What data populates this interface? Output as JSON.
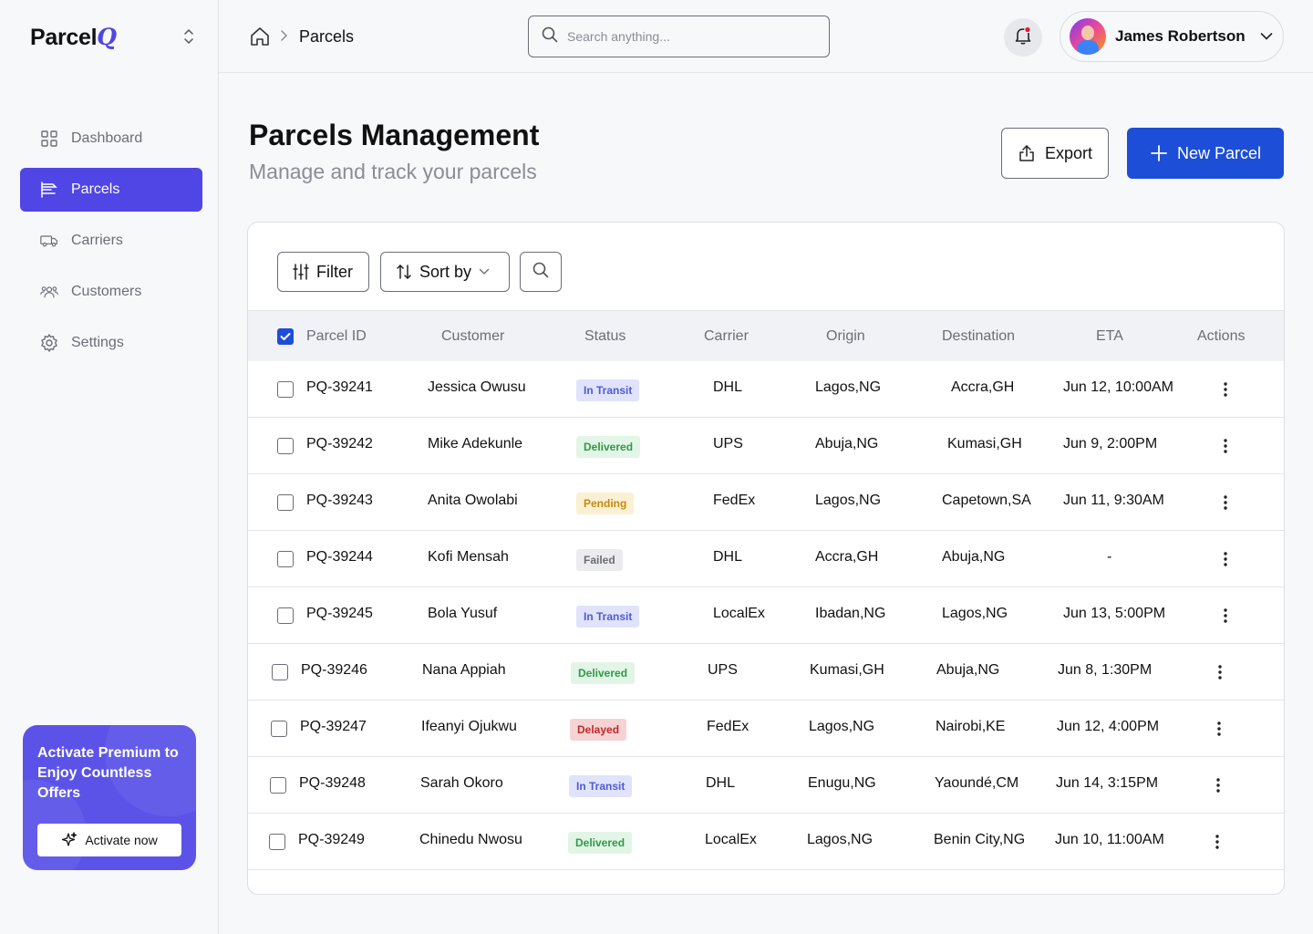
{
  "app": {
    "logo_main": "Parcel",
    "logo_accent": "Q"
  },
  "sidebar": {
    "items": [
      {
        "label": "Dashboard",
        "icon": "grid-icon",
        "active": false
      },
      {
        "label": "Parcels",
        "icon": "parcels-icon",
        "active": true
      },
      {
        "label": "Carriers",
        "icon": "truck-icon",
        "active": false
      },
      {
        "label": "Customers",
        "icon": "users-icon",
        "active": false
      },
      {
        "label": "Settings",
        "icon": "gear-icon",
        "active": false
      }
    ],
    "premium": {
      "text": "Activate Premium to Enjoy Countless Offers",
      "button_label": "Activate now"
    }
  },
  "header": {
    "breadcrumb_current": "Parcels",
    "search_placeholder": "Search anything...",
    "user_name": "James Robertson"
  },
  "main": {
    "title": "Parcels Management",
    "subtitle": "Manage and track your parcels",
    "export_label": "Export",
    "new_label": "New Parcel",
    "filter_label": "Filter",
    "sort_label": "Sort by"
  },
  "table": {
    "columns": [
      "Parcel ID",
      "Customer",
      "Status",
      "Carrier",
      "Origin",
      "Destination",
      "ETA",
      "Actions"
    ],
    "rows": [
      {
        "id": "PQ-39241",
        "customer": "Jessica Owusu",
        "status": "In Transit",
        "status_type": "transit",
        "carrier": "DHL",
        "origin": "Lagos,NG",
        "destination": "Accra,GH",
        "eta": "Jun 12, 10:00AM"
      },
      {
        "id": "PQ-39242",
        "customer": "Mike Adekunle",
        "status": "Delivered",
        "status_type": "delivered",
        "carrier": "UPS",
        "origin": "Abuja,NG",
        "destination": "Kumasi,GH",
        "eta": "Jun 9, 2:00PM"
      },
      {
        "id": "PQ-39243",
        "customer": "Anita Owolabi",
        "status": "Pending",
        "status_type": "pending",
        "carrier": "FedEx",
        "origin": "Lagos,NG",
        "destination": "Capetown,SA",
        "eta": "Jun 11, 9:30AM"
      },
      {
        "id": "PQ-39244",
        "customer": "Kofi Mensah",
        "status": "Failed",
        "status_type": "failed",
        "carrier": "DHL",
        "origin": "Accra,GH",
        "destination": "Abuja,NG",
        "eta": "-"
      },
      {
        "id": "PQ-39245",
        "customer": "Bola Yusuf",
        "status": "In Transit",
        "status_type": "transit",
        "carrier": "LocalEx",
        "origin": "Ibadan,NG",
        "destination": "Lagos,NG",
        "eta": "Jun 13, 5:00PM"
      },
      {
        "id": "PQ-39246",
        "customer": "Nana Appiah",
        "status": "Delivered",
        "status_type": "delivered",
        "carrier": "UPS",
        "origin": "Kumasi,GH",
        "destination": "Abuja,NG",
        "eta": "Jun 8, 1:30PM"
      },
      {
        "id": "PQ-39247",
        "customer": "Ifeanyi Ojukwu",
        "status": "Delayed",
        "status_type": "delayed",
        "carrier": "FedEx",
        "origin": "Lagos,NG",
        "destination": "Nairobi,KE",
        "eta": "Jun 12, 4:00PM"
      },
      {
        "id": "PQ-39248",
        "customer": "Sarah Okoro",
        "status": "In Transit",
        "status_type": "transit",
        "carrier": "DHL",
        "origin": "Enugu,NG",
        "destination": "Yaoundé,CM",
        "eta": "Jun 14, 3:15PM"
      },
      {
        "id": "PQ-39249",
        "customer": "Chinedu Nwosu",
        "status": "Delivered",
        "status_type": "delivered",
        "carrier": "LocalEx",
        "origin": "Lagos,NG",
        "destination": "Benin City,NG",
        "eta": "Jun 10, 11:00AM"
      }
    ]
  },
  "colors": {
    "accent": "#4f46e5",
    "primary_button": "#1d4ed8"
  }
}
